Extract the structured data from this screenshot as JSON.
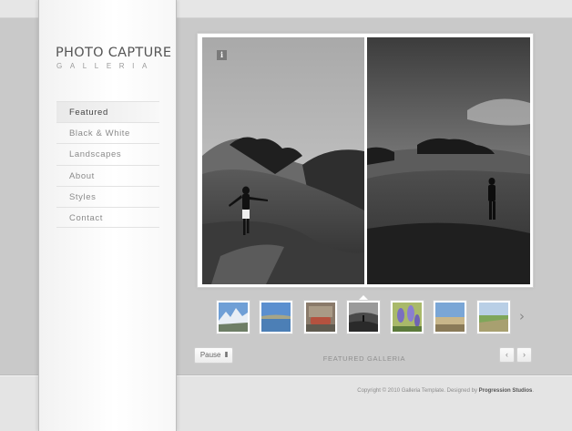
{
  "logo": {
    "title": "PHOTO CAPTURE",
    "subtitle": "GALLERIA"
  },
  "nav": {
    "items": [
      {
        "label": "Featured",
        "active": true
      },
      {
        "label": "Black & White",
        "active": false
      },
      {
        "label": "Landscapes",
        "active": false
      },
      {
        "label": "About",
        "active": false
      },
      {
        "label": "Styles",
        "active": false
      },
      {
        "label": "Contact",
        "active": false
      }
    ]
  },
  "gallery": {
    "info_icon": "i",
    "caption": "FEATURED GALLERIA",
    "pause_label": "Pause",
    "pause_bars": "II",
    "prev_arrow": "‹",
    "next_arrow": "›",
    "thumbs_next": "›",
    "thumbnails": [
      {
        "icon": "mountain-thumbnail",
        "colors": [
          "#6f9fd6",
          "#e8eef5",
          "#6e7e66"
        ]
      },
      {
        "icon": "lake-thumbnail",
        "colors": [
          "#5b8fcf",
          "#4c7fb6",
          "#a6a588"
        ]
      },
      {
        "icon": "car-thumbnail",
        "colors": [
          "#8a7a6a",
          "#b4523f",
          "#5f5a4f"
        ]
      },
      {
        "icon": "bw-hills-thumbnail",
        "colors": [
          "#9a9a9a",
          "#4a4a4a",
          "#2a2a2a"
        ],
        "active": true
      },
      {
        "icon": "lavender-thumbnail",
        "colors": [
          "#a9b96a",
          "#7a6fc0",
          "#5c7a3c"
        ]
      },
      {
        "icon": "field-thumbnail",
        "colors": [
          "#7aa6d6",
          "#c8b68a",
          "#8a7a58"
        ]
      },
      {
        "icon": "green-field-thumbnail",
        "colors": [
          "#b9cfe6",
          "#7fa65a",
          "#a8a070"
        ]
      }
    ]
  },
  "footer": {
    "copyright_prefix": "Copyright © 2010 Galleria Template. Designed by ",
    "studio": "Progression Studios",
    "suffix": "."
  }
}
